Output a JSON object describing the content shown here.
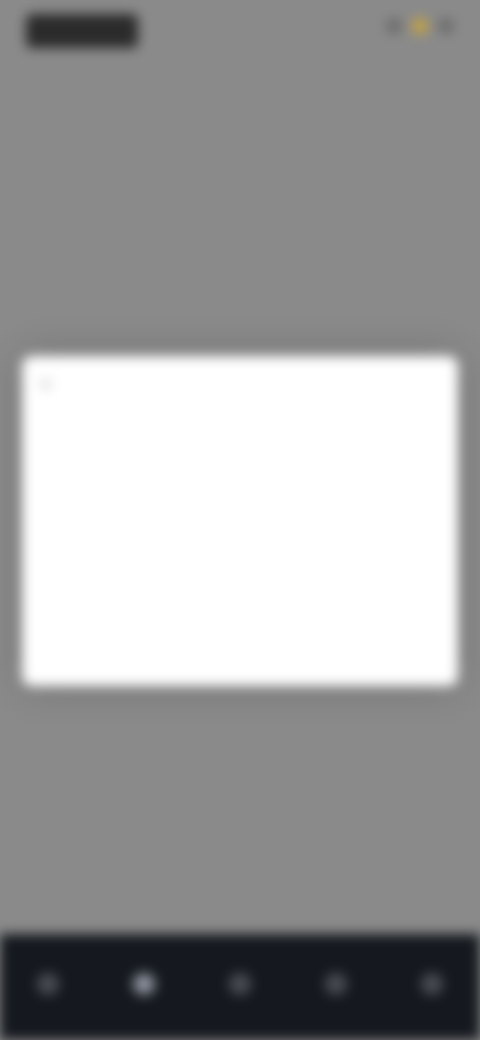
{
  "status_bar": {
    "time": "",
    "icons": [
      "signal-icon",
      "wifi-icon",
      "battery-icon"
    ]
  },
  "header": {
    "title": "",
    "action": ""
  },
  "background": {
    "back": "",
    "card_title": "",
    "card_subtitle": "",
    "row": [
      "",
      "",
      ""
    ],
    "small": ""
  },
  "modal": {
    "close_icon": "×",
    "title": "",
    "edit": "",
    "subtitle": "",
    "columns": [
      "",
      "",
      ""
    ],
    "sections": [
      {
        "title": "",
        "value": "",
        "meta": "",
        "link": ""
      },
      {
        "title": "",
        "value": "",
        "meta": "",
        "link": ""
      }
    ]
  },
  "bottom_nav": {
    "items": [
      "",
      "",
      "",
      "",
      ""
    ]
  },
  "colors": {
    "dim_background": "#8a8a8a",
    "modal_bg": "#ffffff",
    "accent_teal": "#74c6c2",
    "nav_bg": "#15191f"
  }
}
